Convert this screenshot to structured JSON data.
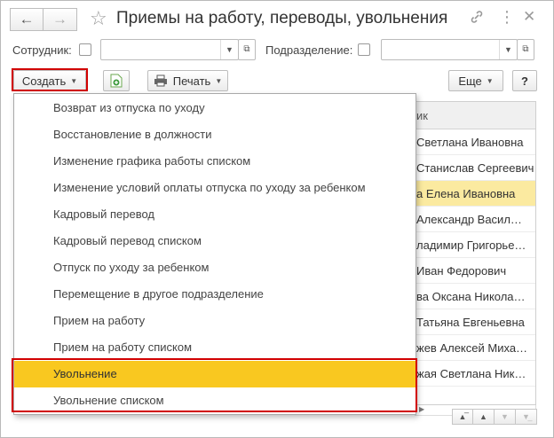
{
  "window": {
    "title": "Приемы на работу, переводы, увольнения"
  },
  "nav": {
    "back_icon": "arrow-left-icon",
    "forward_icon": "arrow-right-icon"
  },
  "filters": {
    "employee_label": "Сотрудник:",
    "employee_value": "",
    "department_label": "Подразделение:",
    "department_value": ""
  },
  "toolbar": {
    "create_label": "Создать",
    "print_label": "Печать",
    "more_label": "Еще",
    "help_label": "?"
  },
  "table": {
    "header": "ик",
    "rows": [
      "Светлана Ивановна",
      "Станислав Сергеевич",
      "а Елена Ивановна",
      "Александр Васил…",
      "ладимир Григорье…",
      "Иван Федорович",
      "ва Оксана Никола…",
      "Татьяна Евгеньевна",
      "жев Алексей Миха…",
      "жая Светлана Ник…"
    ],
    "selected_row": 2
  },
  "menu": {
    "items": [
      "Возврат из отпуска по уходу",
      "Восстановление в должности",
      "Изменение графика работы списком",
      "Изменение условий оплаты отпуска по уходу за ребенком",
      "Кадровый перевод",
      "Кадровый перевод списком",
      "Отпуск по уходу за ребенком",
      "Перемещение в другое подразделение",
      "Прием на работу",
      "Прием на работу списком",
      "Увольнение",
      "Увольнение списком"
    ],
    "active_index": 10
  },
  "colors": {
    "highlight": "#d10000",
    "active_item": "#f9c820",
    "selected_row": "#fbeaa0"
  }
}
